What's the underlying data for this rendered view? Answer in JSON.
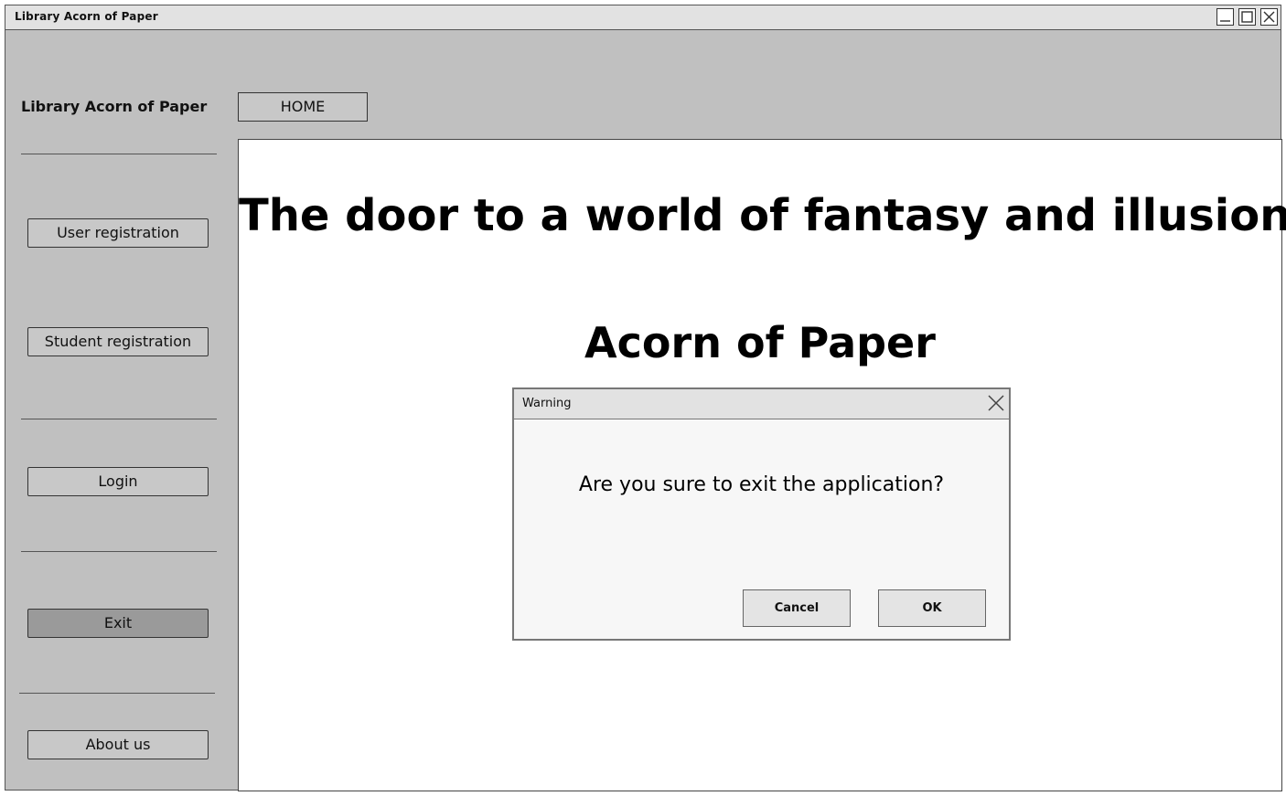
{
  "window": {
    "title": "Library Acorn of Paper",
    "controls": [
      "minimize-icon",
      "maximize-icon",
      "close-icon"
    ]
  },
  "sidebar": {
    "brand": "Library Acorn of Paper",
    "buttons": [
      {
        "label": "User registration"
      },
      {
        "label": "Student registration"
      },
      {
        "label": "Login"
      },
      {
        "label": "Exit",
        "active": true
      },
      {
        "label": "About us"
      }
    ]
  },
  "nav": {
    "home_label": "HOME"
  },
  "main": {
    "headline": "The door to a world of fantasy and illusion.",
    "subhead": "Acorn of Paper"
  },
  "dialog": {
    "title": "Warning",
    "message": "Are you sure to exit the application?",
    "cancel_label": "Cancel",
    "ok_label": "OK"
  },
  "colors": {
    "window_bg": "#c0c0c0",
    "titlebar_bg": "#e2e2e2",
    "content_bg": "#ffffff",
    "active_button_bg": "#9a9a9a"
  }
}
